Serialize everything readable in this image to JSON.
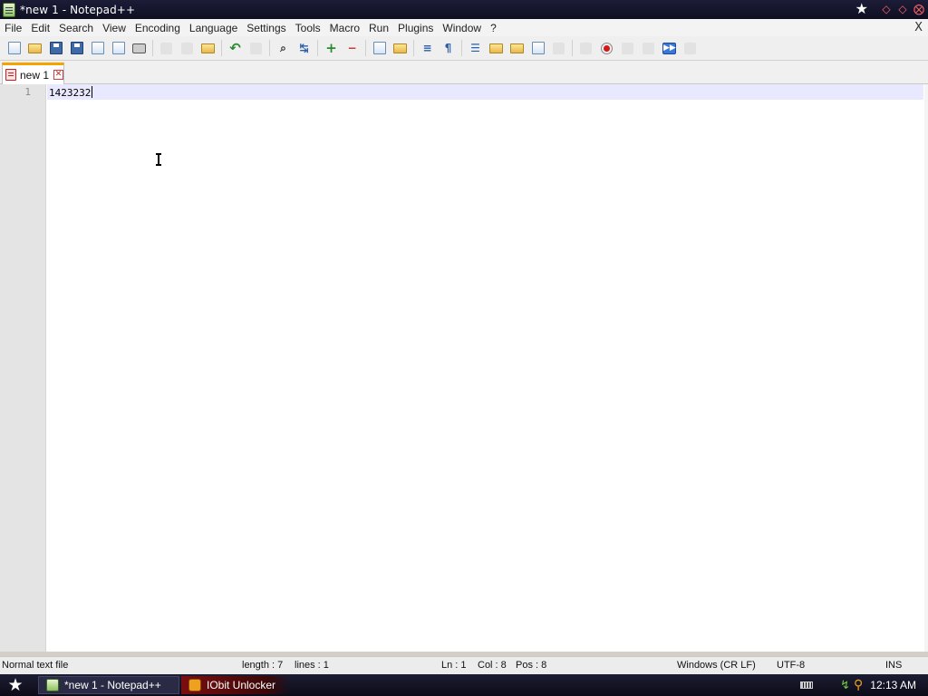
{
  "window": {
    "title": "*new 1 - Notepad++",
    "close_glyph": "X"
  },
  "menu": [
    "File",
    "Edit",
    "Search",
    "View",
    "Encoding",
    "Language",
    "Settings",
    "Tools",
    "Macro",
    "Run",
    "Plugins",
    "Window",
    "?"
  ],
  "tab": {
    "label": "new 1",
    "close_glyph": "✕"
  },
  "editor": {
    "line_number": "1",
    "content": "1423232"
  },
  "status": {
    "file_type": "Normal text file",
    "length": "length : 7",
    "lines": "lines : 1",
    "ln": "Ln : 1",
    "col": "Col : 8",
    "pos": "Pos : 8",
    "eol": "Windows (CR LF)",
    "encoding": "UTF-8",
    "mode": "INS"
  },
  "taskbar": {
    "tasks": [
      {
        "label": "*new 1 - Notepad++",
        "icon": "notepad-icon"
      },
      {
        "label": "IObit Unlocker",
        "icon": "lock-icon"
      }
    ],
    "clock": "12:13 AM"
  },
  "colors": {
    "title_bg": "#1c1c38",
    "current_line": "#e8e8ff",
    "tab_accent": "#f4a300"
  }
}
